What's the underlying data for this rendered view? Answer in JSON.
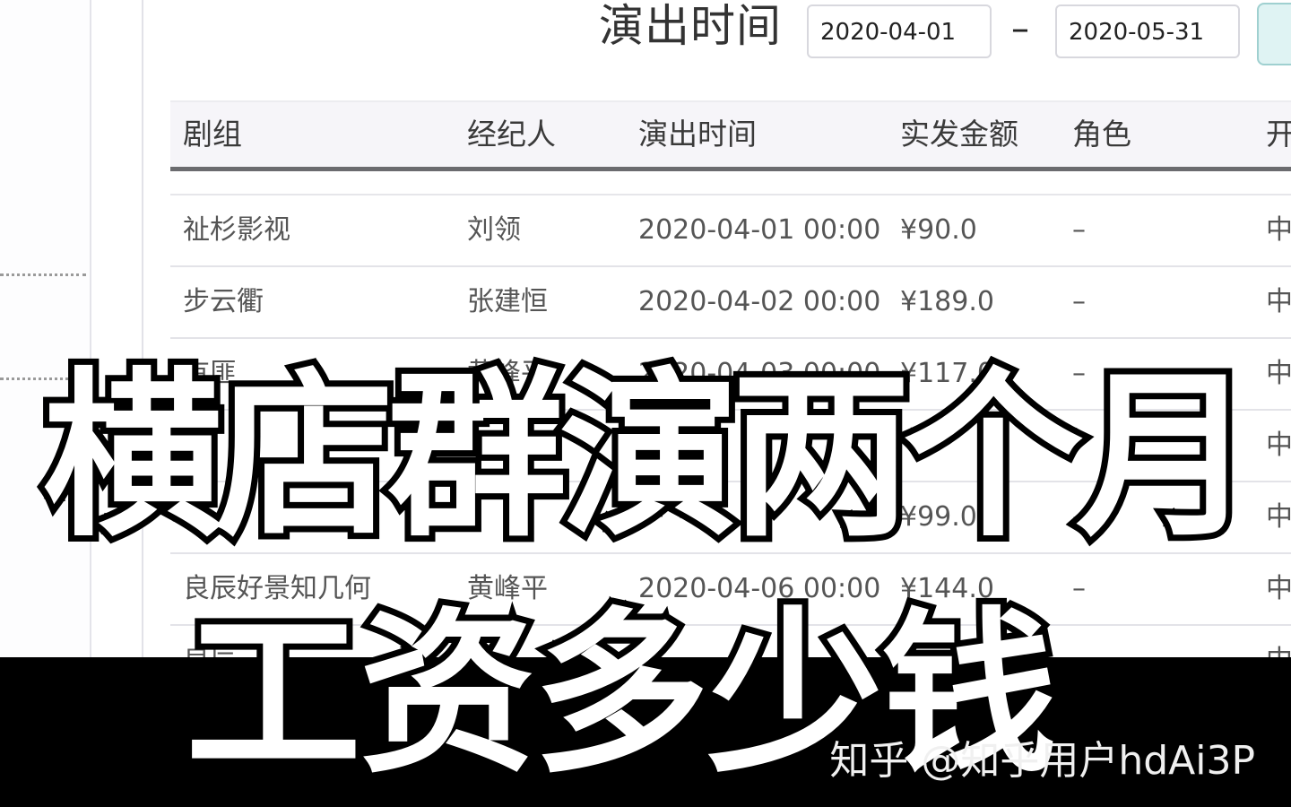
{
  "filter": {
    "label": "演出时间",
    "start_date": "2020-04-01",
    "separator": "–",
    "end_date": "2020-05-31"
  },
  "table": {
    "columns": [
      "剧组",
      "经纪人",
      "演出时间",
      "实发金额",
      "角色",
      "开"
    ],
    "rows": [
      [
        "祉杉影视",
        "刘领",
        "2020-04-01 00:00",
        "¥90.0",
        "–",
        "中"
      ],
      [
        "步云衢",
        "张建恒",
        "2020-04-02 00:00",
        "¥189.0",
        "–",
        "中"
      ],
      [
        "有匪",
        "黄峰平",
        "2020-04-03 00:00",
        "¥117.0",
        "–",
        "中"
      ],
      [
        "",
        "",
        "",
        "",
        "",
        "中"
      ],
      [
        "",
        "",
        "",
        "¥99.0",
        "–",
        "中"
      ],
      [
        "良辰好景知几何",
        "黄峰平",
        "2020-04-06 00:00",
        "¥144.0",
        "–",
        "中"
      ],
      [
        "良辰",
        "",
        "",
        "",
        "",
        "中"
      ]
    ]
  },
  "overlay": {
    "headline_line1": "横店群演两个月",
    "headline_line2": "工资多少钱",
    "watermark": "知乎 @知乎用户hdAi3P"
  }
}
